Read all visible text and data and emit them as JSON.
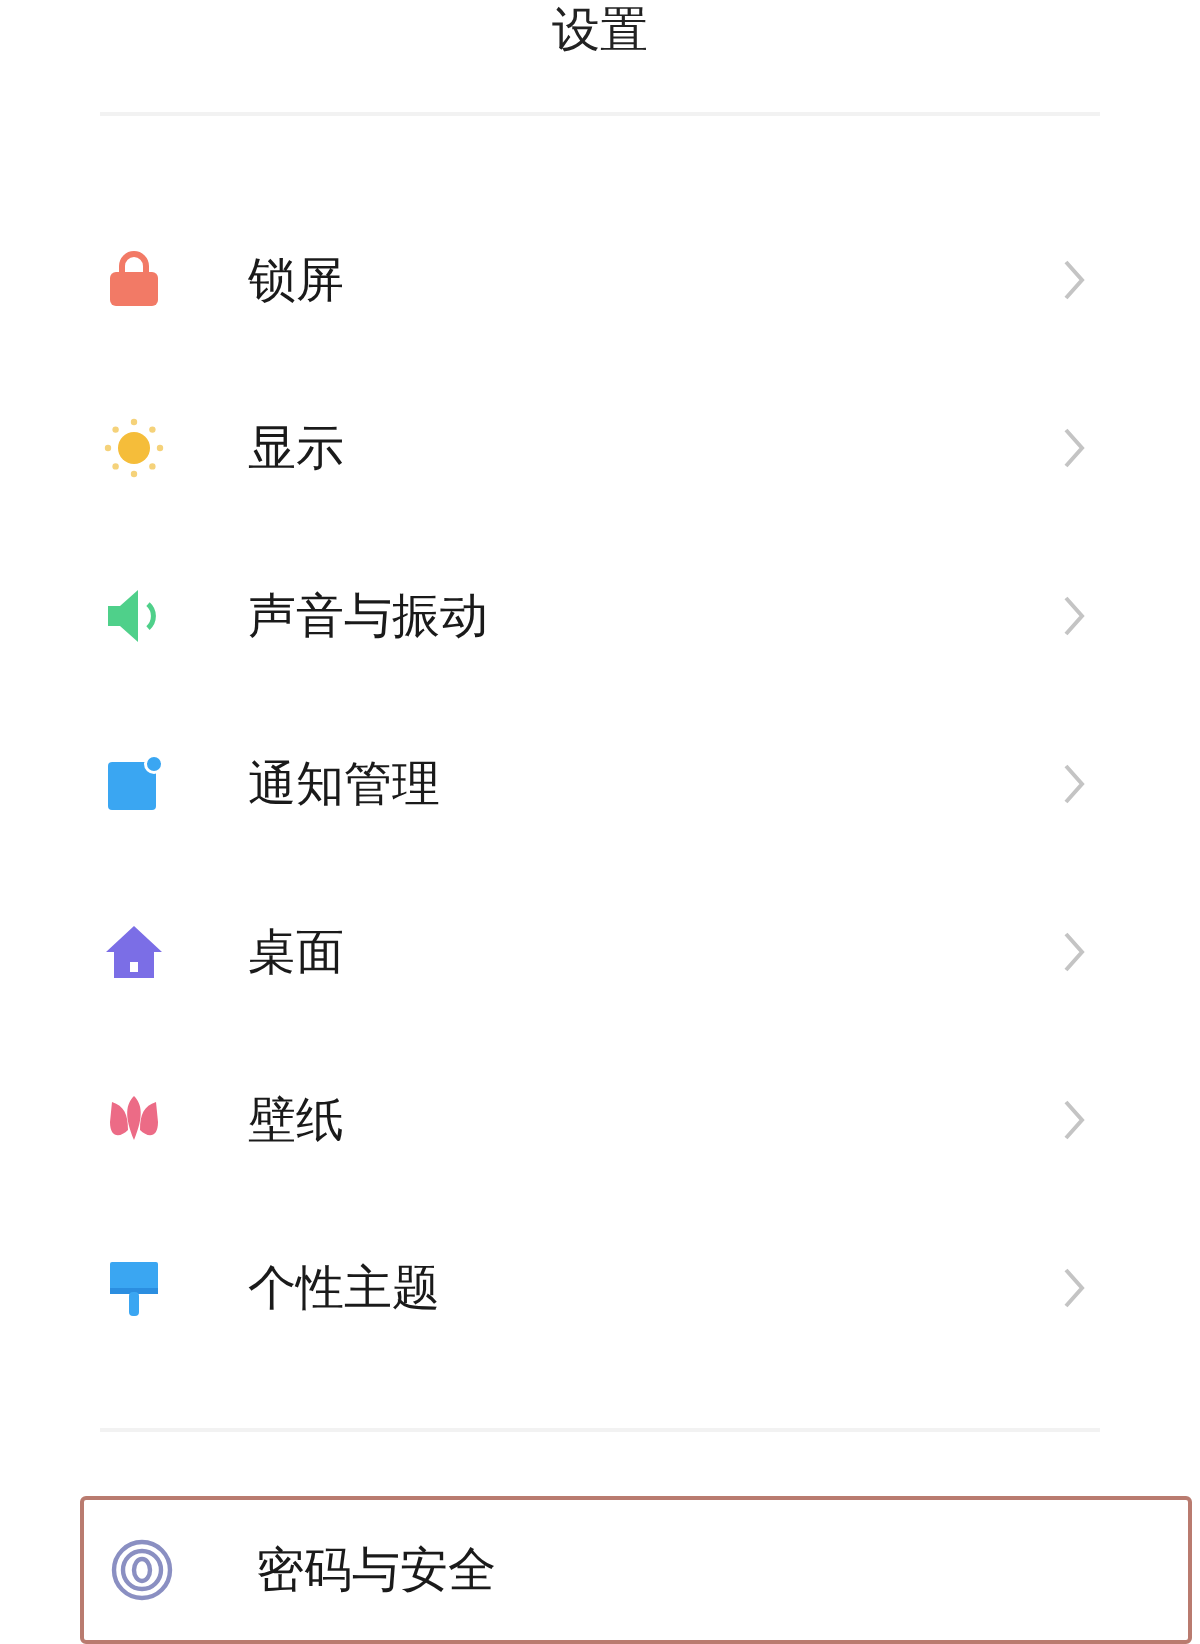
{
  "title": "设置",
  "groups": [
    {
      "items": [
        {
          "kind": "lock",
          "label": "锁屏",
          "chevron": true,
          "highlighted": false
        },
        {
          "kind": "sun",
          "label": "显示",
          "chevron": true,
          "highlighted": false
        },
        {
          "kind": "speaker",
          "label": "声音与振动",
          "chevron": true,
          "highlighted": false
        },
        {
          "kind": "notification",
          "label": "通知管理",
          "chevron": true,
          "highlighted": false
        },
        {
          "kind": "home",
          "label": "桌面",
          "chevron": true,
          "highlighted": false
        },
        {
          "kind": "tulip",
          "label": "壁纸",
          "chevron": true,
          "highlighted": false
        },
        {
          "kind": "brush",
          "label": "个性主题",
          "chevron": true,
          "highlighted": false
        }
      ]
    },
    {
      "items": [
        {
          "kind": "fingerprint",
          "label": "密码与安全",
          "chevron": false,
          "highlighted": true
        }
      ]
    }
  ]
}
